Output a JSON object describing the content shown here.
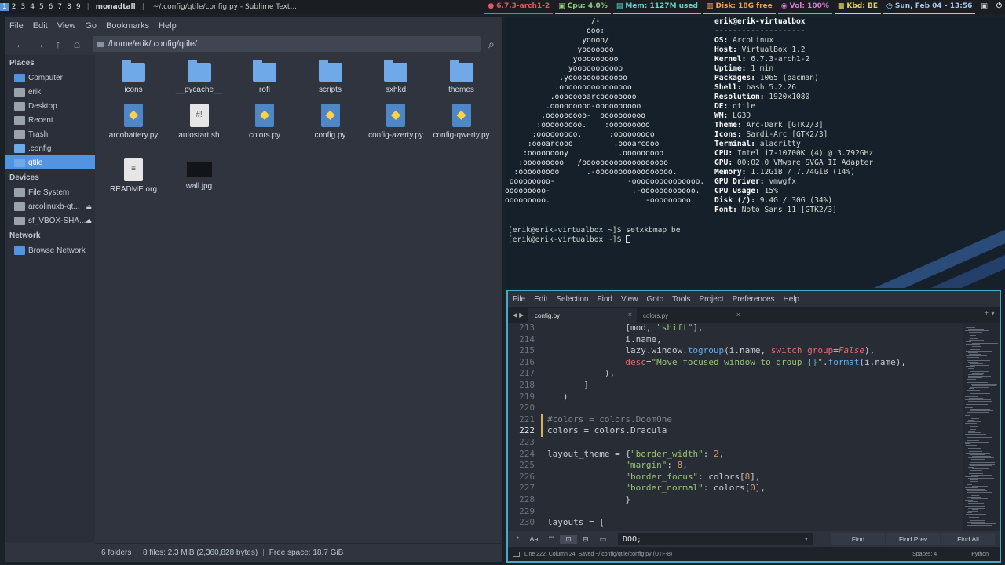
{
  "topbar": {
    "groups": [
      "1",
      "2",
      "3",
      "4",
      "5",
      "6",
      "7",
      "8",
      "9"
    ],
    "active_group": "1",
    "layout": "monadtall",
    "window_title": "~/.config/qtile/config.py - Sublime Text...",
    "widgets": [
      {
        "name": "kernel",
        "icon": "●",
        "text": "6.7.3-arch1-2",
        "color": "#e05a5a"
      },
      {
        "name": "cpu",
        "icon": "▣",
        "text": "Cpu: 4.0%",
        "color": "#8bd17c"
      },
      {
        "name": "memory",
        "icon": "▤",
        "text": "Mem: 1127M used",
        "color": "#5fd7c6"
      },
      {
        "name": "disk",
        "icon": "▥",
        "text": "Disk: 18G free",
        "color": "#f0a14a"
      },
      {
        "name": "volume",
        "icon": "◉",
        "text": "Vol: 100%",
        "color": "#d67bd6"
      },
      {
        "name": "keyboard",
        "icon": "▦",
        "text": "Kbd: BE",
        "color": "#e6d96a"
      },
      {
        "name": "clock",
        "icon": "◷",
        "text": "Sun, Feb 04 - 13:56",
        "color": "#a8c8f0"
      }
    ],
    "tray": [
      "▣",
      "⏻"
    ]
  },
  "filemanager": {
    "menu": [
      "File",
      "Edit",
      "View",
      "Go",
      "Bookmarks",
      "Help"
    ],
    "path": "/home/erik/.config/qtile/",
    "sidebar": {
      "places_header": "Places",
      "places": [
        {
          "label": "Computer",
          "color": "#5294e2"
        },
        {
          "label": "erik",
          "color": "#9aa3ad"
        },
        {
          "label": "Desktop",
          "color": "#9aa3ad"
        },
        {
          "label": "Recent",
          "color": "#9aa3ad"
        },
        {
          "label": "Trash",
          "color": "#9aa3ad"
        },
        {
          "label": ".config",
          "color": "#6fa9e8"
        },
        {
          "label": "qtile",
          "color": "#6fa9e8"
        }
      ],
      "devices_header": "Devices",
      "devices": [
        {
          "label": "File System",
          "color": "#9aa3ad"
        },
        {
          "label": "arcolinuxb-qt...",
          "color": "#9aa3ad"
        },
        {
          "label": "sf_VBOX-SHA...",
          "color": "#9aa3ad"
        }
      ],
      "network_header": "Network",
      "network": [
        {
          "label": "Browse Network",
          "color": "#5294e2"
        }
      ]
    },
    "files": [
      {
        "name": "icons",
        "type": "folder"
      },
      {
        "name": "__pycache__",
        "type": "folder"
      },
      {
        "name": "rofi",
        "type": "folder"
      },
      {
        "name": "scripts",
        "type": "folder"
      },
      {
        "name": "sxhkd",
        "type": "folder"
      },
      {
        "name": "themes",
        "type": "folder"
      },
      {
        "name": "arcobattery.py",
        "type": "py"
      },
      {
        "name": "autostart.sh",
        "type": "doc"
      },
      {
        "name": "colors.py",
        "type": "py"
      },
      {
        "name": "config.py",
        "type": "py"
      },
      {
        "name": "config-azerty.py",
        "type": "py"
      },
      {
        "name": "config-qwerty.py",
        "type": "py"
      },
      {
        "name": "README.org",
        "type": "doc"
      },
      {
        "name": "wall.jpg",
        "type": "jpg"
      }
    ],
    "status": {
      "folders": "6 folders",
      "files": "8 files: 2.3 MiB (2,360,828 bytes)",
      "free": "Free space: 18.7 GiB"
    }
  },
  "terminal": {
    "ascii": "                   /-\n                  ooo:\n                 yoooo/\n                yooooooo\n               yooooooooo\n              yooooooooooo\n            .yooooooooooooo\n           .oooooooooooooooo\n          .oooooooarcoooooooo\n         .ooooooooo-oooooooooo\n        .ooooooooo-  oooooooooo\n       :ooooooooo.    :ooooooooo\n      :ooooooooo.      :ooooooooo\n     :oooarcooo         .oooarcooo\n    :ooooooooy           .ooooooooo\n   :ooooooooo   /ooooooooooooooooooo\n  :ooooooooo      .-ooooooooooooooooo.\n ooooooooo-                -ooooooooooooooo.\nooooooooo-                  .-oooooooooooo.\nooooooooo.                     -ooooooooo",
    "info": [
      {
        "k": "erik@erik-virtualbox",
        "v": ""
      },
      {
        "k": "",
        "v": "--------------------"
      },
      {
        "k": "OS: ",
        "v": "ArcoLinux"
      },
      {
        "k": "Host: ",
        "v": "VirtualBox 1.2"
      },
      {
        "k": "Kernel: ",
        "v": "6.7.3-arch1-2"
      },
      {
        "k": "Uptime: ",
        "v": "1 min"
      },
      {
        "k": "Packages: ",
        "v": "1065 (pacman)"
      },
      {
        "k": "Shell: ",
        "v": "bash 5.2.26"
      },
      {
        "k": "Resolution: ",
        "v": "1920x1080"
      },
      {
        "k": "DE: ",
        "v": "qtile"
      },
      {
        "k": "WM: ",
        "v": "LG3D"
      },
      {
        "k": "Theme: ",
        "v": "Arc-Dark [GTK2/3]"
      },
      {
        "k": "Icons: ",
        "v": "Sardi-Arc [GTK2/3]"
      },
      {
        "k": "Terminal: ",
        "v": "alacritty"
      },
      {
        "k": "CPU: ",
        "v": "Intel i7-10700K (4) @ 3.792GHz"
      },
      {
        "k": "GPU: ",
        "v": "00:02.0 VMware SVGA II Adapter"
      },
      {
        "k": "Memory: ",
        "v": "1.12GiB / 7.74GiB (14%)"
      },
      {
        "k": "GPU Driver: ",
        "v": "vmwgfx"
      },
      {
        "k": "CPU Usage: ",
        "v": "15%"
      },
      {
        "k": "Disk (/): ",
        "v": "9.4G / 30G (34%)"
      },
      {
        "k": "Font: ",
        "v": "Noto Sans 11 [GTK2/3]"
      }
    ],
    "line1": "[erik@erik-virtualbox ~]$ setxkbmap be",
    "line2": "[erik@erik-virtualbox ~]$ "
  },
  "sublime": {
    "menu": [
      "File",
      "Edit",
      "Selection",
      "Find",
      "View",
      "Goto",
      "Tools",
      "Project",
      "Preferences",
      "Help"
    ],
    "tabs": [
      {
        "label": "config.py",
        "active": true
      },
      {
        "label": "colors.py",
        "active": false
      }
    ],
    "lines": [
      {
        "n": "213",
        "html": "               [mod, <span class='s'>\"shift\"</span>],"
      },
      {
        "n": "214",
        "html": "               i.name,"
      },
      {
        "n": "215",
        "html": "               lazy.window.<span class='fn'>togroup</span>(i.name, <span class='p'>switch_group</span>=<span class='fl'>False</span>),"
      },
      {
        "n": "216",
        "html": "               <span class='p'>desc</span>=<span class='s'>\"Move focused window to group </span><span class='b'>{}</span><span class='s'>\"</span>.<span class='fn'>format</span>(i.name),"
      },
      {
        "n": "217",
        "html": "           ),"
      },
      {
        "n": "218",
        "html": "       ]"
      },
      {
        "n": "219",
        "html": "   )"
      },
      {
        "n": "220",
        "html": ""
      },
      {
        "n": "221",
        "html": "<span class='c'>#colors = colors.DoomOne</span>",
        "mod": true
      },
      {
        "n": "222",
        "html": "colors = colors.Dracula<span id='caret'></span>",
        "mod": true,
        "cur": true
      },
      {
        "n": "223",
        "html": ""
      },
      {
        "n": "224",
        "html": "layout_theme = {<span class='s'>\"border_width\"</span>: <span class='n'>2</span>,"
      },
      {
        "n": "225",
        "html": "               <span class='s'>\"margin\"</span>: <span class='n'>8</span>,"
      },
      {
        "n": "226",
        "html": "               <span class='s'>\"border_focus\"</span>: colors[<span class='n'>8</span>],"
      },
      {
        "n": "227",
        "html": "               <span class='s'>\"border_normal\"</span>: colors[<span class='n'>0</span>],"
      },
      {
        "n": "228",
        "html": "               }"
      },
      {
        "n": "229",
        "html": ""
      },
      {
        "n": "230",
        "html": "layouts = ["
      }
    ],
    "find": {
      "toggles": [
        ".*",
        "Aa",
        "“”",
        "⊡",
        "⊟",
        "▭"
      ],
      "query": "DOO;",
      "find_label": "Find",
      "find_prev_label": "Find Prev",
      "find_all_label": "Find All"
    },
    "status": {
      "left": "Line 222, Column 24; Saved ~/.config/qtile/config.py (UTF-8)",
      "spaces": "Spaces: 4",
      "syntax": "Python"
    }
  }
}
